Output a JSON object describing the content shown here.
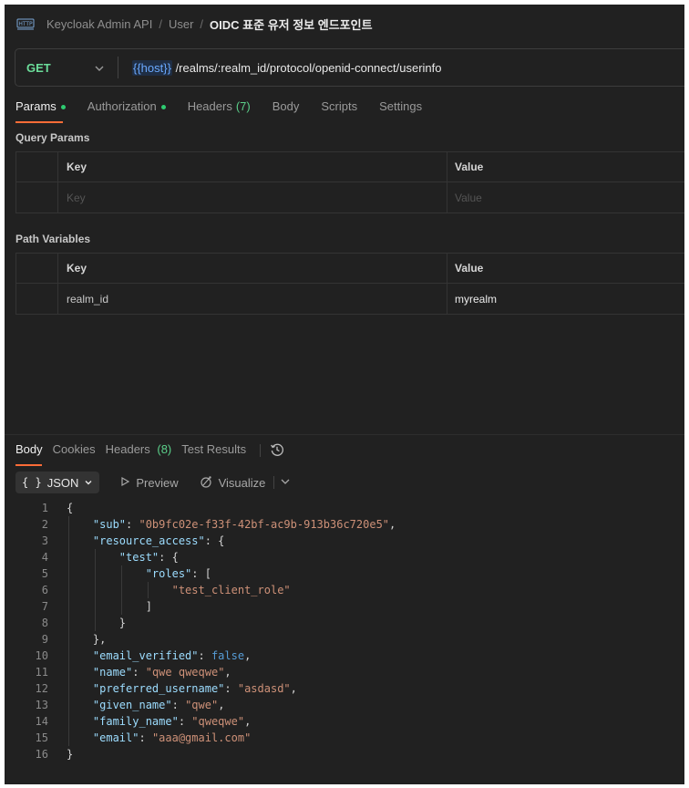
{
  "breadcrumb": {
    "collection": "Keycloak Admin API",
    "folder": "User",
    "request": "OIDC 표준 유저 정보 엔드포인트",
    "separator": "/"
  },
  "request": {
    "method": "GET",
    "url_variable": "{{host}}",
    "url_path": " /realms/:realm_id/protocol/openid-connect/userinfo"
  },
  "request_tabs": [
    {
      "label": "Params",
      "dot": true,
      "active": true
    },
    {
      "label": "Authorization",
      "dot": true
    },
    {
      "label": "Headers",
      "count": "(7)"
    },
    {
      "label": "Body"
    },
    {
      "label": "Scripts"
    },
    {
      "label": "Settings"
    }
  ],
  "query_params": {
    "title": "Query Params",
    "key_header": "Key",
    "value_header": "Value",
    "key_placeholder": "Key",
    "value_placeholder": "Value"
  },
  "path_variables": {
    "title": "Path Variables",
    "key_header": "Key",
    "value_header": "Value",
    "rows": [
      {
        "key": "realm_id",
        "value": "myrealm"
      }
    ]
  },
  "response_tabs": [
    {
      "label": "Body",
      "active": true
    },
    {
      "label": "Cookies"
    },
    {
      "label": "Headers",
      "count": "(8)"
    },
    {
      "label": "Test Results"
    }
  ],
  "response_toolbar": {
    "format_braces": "{ }",
    "format": "JSON",
    "preview": "Preview",
    "visualize": "Visualize"
  },
  "response_body": {
    "lines": [
      {
        "n": "1",
        "indent": 0,
        "parts": [
          [
            "p",
            "{"
          ]
        ]
      },
      {
        "n": "2",
        "indent": 1,
        "parts": [
          [
            "k",
            "\"sub\""
          ],
          [
            "p",
            ": "
          ],
          [
            "s",
            "\"0b9fc02e-f33f-42bf-ac9b-913b36c720e5\""
          ],
          [
            "p",
            ","
          ]
        ]
      },
      {
        "n": "3",
        "indent": 1,
        "parts": [
          [
            "k",
            "\"resource_access\""
          ],
          [
            "p",
            ": {"
          ]
        ]
      },
      {
        "n": "4",
        "indent": 2,
        "parts": [
          [
            "k",
            "\"test\""
          ],
          [
            "p",
            ": {"
          ]
        ]
      },
      {
        "n": "5",
        "indent": 3,
        "parts": [
          [
            "k",
            "\"roles\""
          ],
          [
            "p",
            ": ["
          ]
        ]
      },
      {
        "n": "6",
        "indent": 4,
        "parts": [
          [
            "s",
            "\"test_client_role\""
          ]
        ]
      },
      {
        "n": "7",
        "indent": 3,
        "parts": [
          [
            "p",
            "]"
          ]
        ]
      },
      {
        "n": "8",
        "indent": 2,
        "parts": [
          [
            "p",
            "}"
          ]
        ]
      },
      {
        "n": "9",
        "indent": 1,
        "parts": [
          [
            "p",
            "},"
          ]
        ]
      },
      {
        "n": "10",
        "indent": 1,
        "parts": [
          [
            "k",
            "\"email_verified\""
          ],
          [
            "p",
            ": "
          ],
          [
            "b",
            "false"
          ],
          [
            "p",
            ","
          ]
        ]
      },
      {
        "n": "11",
        "indent": 1,
        "parts": [
          [
            "k",
            "\"name\""
          ],
          [
            "p",
            ": "
          ],
          [
            "s",
            "\"qwe qweqwe\""
          ],
          [
            "p",
            ","
          ]
        ]
      },
      {
        "n": "12",
        "indent": 1,
        "parts": [
          [
            "k",
            "\"preferred_username\""
          ],
          [
            "p",
            ": "
          ],
          [
            "s",
            "\"asdasd\""
          ],
          [
            "p",
            ","
          ]
        ]
      },
      {
        "n": "13",
        "indent": 1,
        "parts": [
          [
            "k",
            "\"given_name\""
          ],
          [
            "p",
            ": "
          ],
          [
            "s",
            "\"qwe\""
          ],
          [
            "p",
            ","
          ]
        ]
      },
      {
        "n": "14",
        "indent": 1,
        "parts": [
          [
            "k",
            "\"family_name\""
          ],
          [
            "p",
            ": "
          ],
          [
            "s",
            "\"qweqwe\""
          ],
          [
            "p",
            ","
          ]
        ]
      },
      {
        "n": "15",
        "indent": 1,
        "parts": [
          [
            "k",
            "\"email\""
          ],
          [
            "p",
            ": "
          ],
          [
            "s",
            "\"aaa@gmail.com\""
          ]
        ]
      },
      {
        "n": "16",
        "indent": 0,
        "parts": [
          [
            "p",
            "}"
          ]
        ]
      }
    ]
  },
  "colors": {
    "background": "#212121",
    "method": "#6bdd9a",
    "active_tab_underline": "#ff6c37",
    "status_dot": "#2ecc71",
    "url_variable": "#6aa9ff",
    "json_key": "#9cdcfe",
    "json_string": "#ce9178",
    "json_boolean": "#569cd6"
  },
  "icons": [
    "http-icon",
    "chevron-down-icon",
    "play-icon",
    "visualize-icon",
    "history-icon"
  ]
}
